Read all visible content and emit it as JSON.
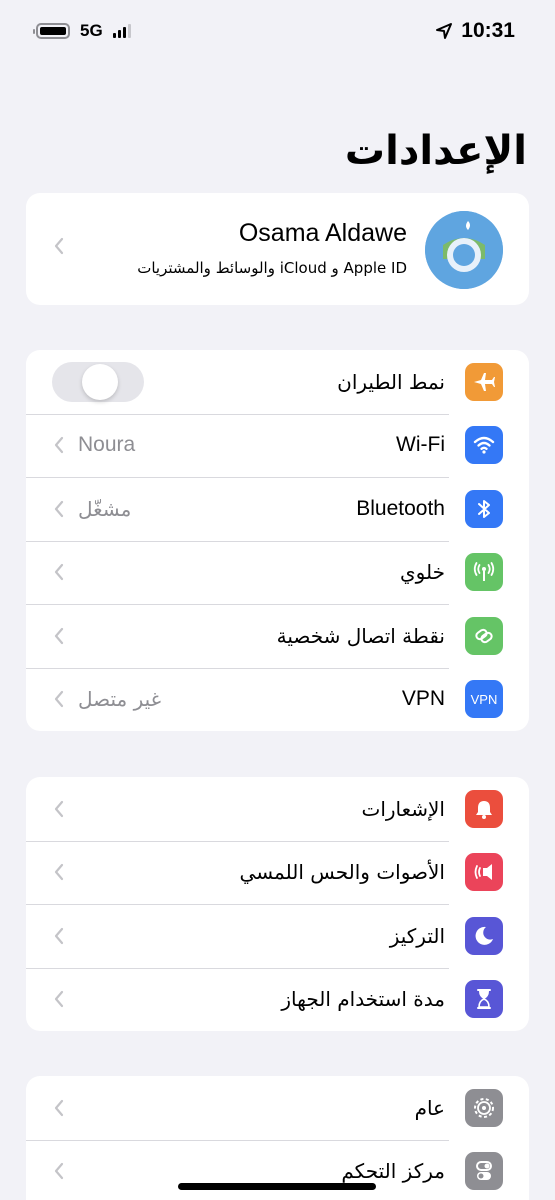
{
  "status_bar": {
    "network": "5G",
    "time": "10:31"
  },
  "page": {
    "title": "الإعدادات"
  },
  "profile": {
    "name": "Osama Aldawe",
    "subtitle": "Apple ID و iCloud والوسائط والمشتريات"
  },
  "group1": [
    {
      "label": "نمط الطيران",
      "value": "",
      "icon": "airplane-icon",
      "color": "#f19a37"
    },
    {
      "label": "Wi-Fi",
      "value": "Noura",
      "icon": "wifi-icon",
      "color": "#3478f6"
    },
    {
      "label": "Bluetooth",
      "value": "مشغّل",
      "icon": "bluetooth-icon",
      "color": "#3478f6"
    },
    {
      "label": "خلوي",
      "value": "",
      "icon": "cellular-icon",
      "color": "#65c466"
    },
    {
      "label": "نقطة اتصال شخصية",
      "value": "",
      "icon": "hotspot-icon",
      "color": "#65c466"
    },
    {
      "label": "VPN",
      "value": "غير متصل",
      "icon": "vpn-icon",
      "color": "#3478f6"
    }
  ],
  "group1_vpn_icon_text": "VPN",
  "group2": [
    {
      "label": "الإشعارات",
      "icon": "notifications-icon",
      "color": "#eb4e3d"
    },
    {
      "label": "الأصوات والحس اللمسي",
      "icon": "sounds-icon",
      "color": "#eb445a"
    },
    {
      "label": "التركيز",
      "icon": "focus-moon-icon",
      "color": "#5856d6"
    },
    {
      "label": "مدة استخدام الجهاز",
      "icon": "screen-time-icon",
      "color": "#5856d6"
    }
  ],
  "group3": [
    {
      "label": "عام",
      "icon": "gear-icon",
      "color": "#8e8e93"
    },
    {
      "label": "مركز التحكم",
      "icon": "control-center-icon",
      "color": "#8e8e93"
    }
  ],
  "airplane_mode": {
    "on": false
  },
  "colors": {
    "background": "#f2f2f7",
    "toggle_off": "#e5e5ea",
    "secondary_text": "#8e8e93"
  }
}
